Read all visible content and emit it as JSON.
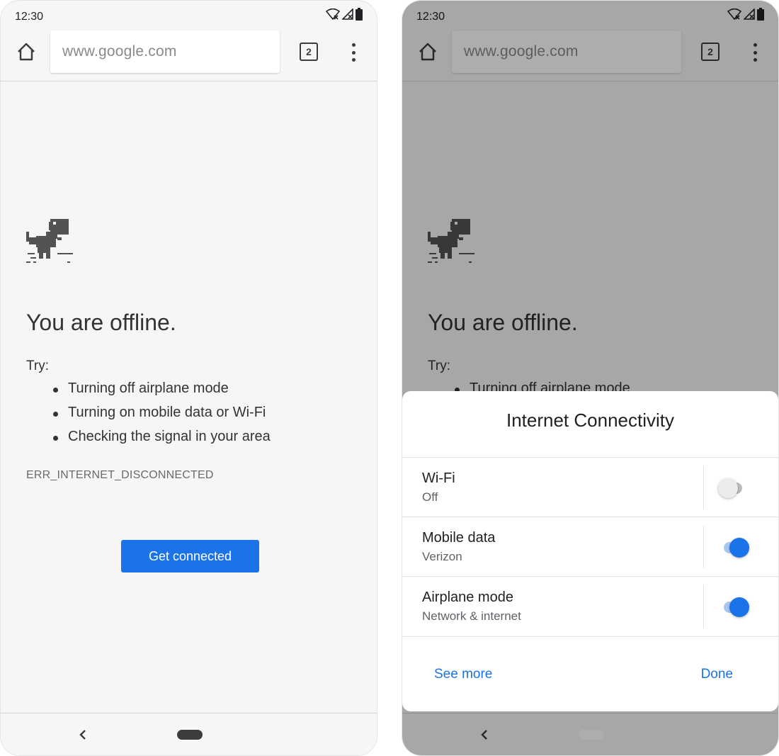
{
  "left_screen": {
    "status_bar": {
      "time": "12:30"
    },
    "toolbar": {
      "url_placeholder": "www.google.com",
      "tab_count": "2"
    },
    "page": {
      "title": "You are offline.",
      "try_label": "Try:",
      "suggestions": [
        "Turning off airplane mode",
        "Turning on mobile data or Wi-Fi",
        "Checking the signal in your area"
      ],
      "error_code": "ERR_INTERNET_DISCONNECTED",
      "button_label": "Get connected"
    }
  },
  "right_screen": {
    "status_bar": {
      "time": "12:30"
    },
    "toolbar": {
      "url_placeholder": "www.google.com",
      "tab_count": "2"
    },
    "page": {
      "title": "You are offline.",
      "try_label": "Try:",
      "suggestions": [
        "Turning off airplane mode"
      ]
    },
    "sheet": {
      "title": "Internet Connectivity",
      "rows": [
        {
          "title": "Wi-Fi",
          "subtitle": "Off",
          "toggle_state": "off"
        },
        {
          "title": "Mobile data",
          "subtitle": "Verizon",
          "toggle_state": "on"
        },
        {
          "title": "Airplane mode",
          "subtitle": "Network & internet",
          "toggle_state": "on"
        }
      ],
      "see_more_label": "See more",
      "done_label": "Done"
    }
  },
  "colors": {
    "accent": "#1a73e8",
    "scrim": "#000000",
    "background": "#f6f6f6"
  }
}
